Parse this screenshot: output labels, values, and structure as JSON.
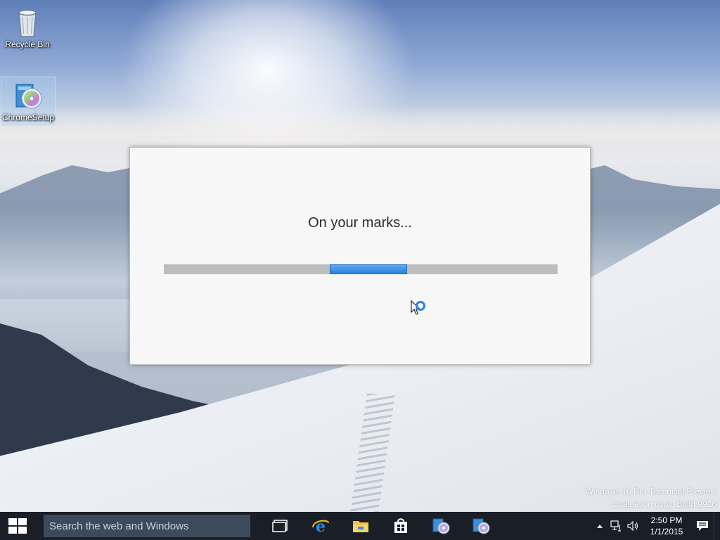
{
  "desktop": {
    "icons": [
      {
        "label": "Recycle Bin",
        "icon": "recycle-bin-icon"
      },
      {
        "label": "ChromeSetup",
        "icon": "installer-disc-icon",
        "selected": true
      }
    ],
    "watermark": {
      "line1": "Windows 10 Pro Technical Preview",
      "line2": "Evaluation copy. Build 9926"
    }
  },
  "installer": {
    "status_text": "On your marks...",
    "progress": {
      "mode": "indeterminate",
      "accent": "#2b82dc",
      "track": "#bdbdbd"
    }
  },
  "cursor": {
    "icon": "busy-cursor-icon"
  },
  "taskbar": {
    "start_icon": "windows-logo-icon",
    "search_placeholder": "Search the web and Windows",
    "apps": [
      {
        "icon": "task-view-icon"
      },
      {
        "icon": "internet-explorer-icon"
      },
      {
        "icon": "file-explorer-icon"
      },
      {
        "icon": "store-icon"
      },
      {
        "icon": "installer-disc-icon"
      },
      {
        "icon": "installer-disc-icon"
      }
    ],
    "tray": {
      "icons": [
        "chevron-up-icon",
        "network-icon",
        "volume-icon"
      ],
      "time": "2:50 PM",
      "date": "1/1/2015",
      "notification_icon": "action-center-icon"
    }
  },
  "colors": {
    "taskbar": "#1a1f27",
    "search_box": "#3c4a5c",
    "dialog_bg": "#f7f7f7"
  }
}
